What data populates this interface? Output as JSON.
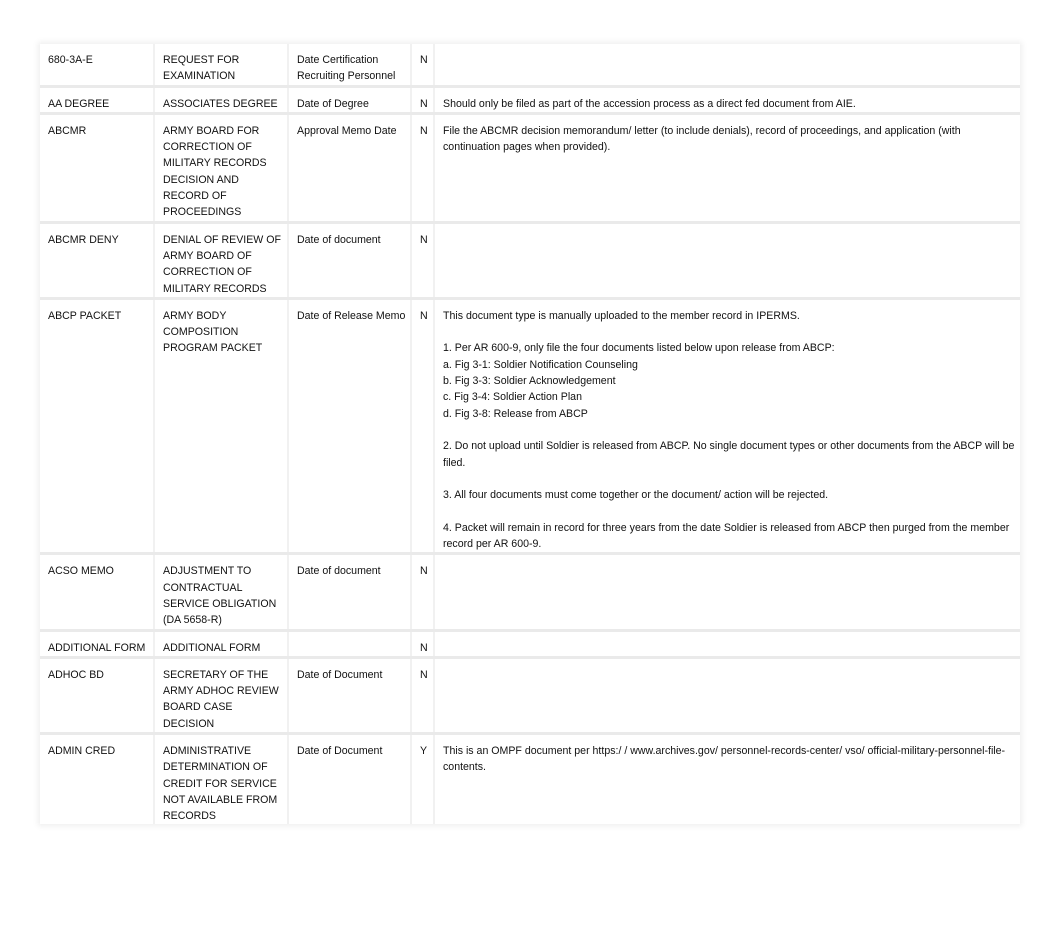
{
  "rows": [
    {
      "code": "680-3A-E",
      "title": "REQUEST FOR\nEXAMINATION",
      "date": "Date Certification Recruiting Personnel",
      "flag": "N",
      "remarks": ""
    },
    {
      "code": "AA DEGREE",
      "title": "ASSOCIATES DEGREE",
      "date": "Date of Degree",
      "flag": "N",
      "remarks": "Should only be filed as part of the accession process as a direct fed document from AIE."
    },
    {
      "code": "ABCMR",
      "title": "ARMY BOARD FOR CORRECTION OF MILITARY RECORDS DECISION AND RECORD OF PROCEEDINGS",
      "date": "Approval Memo Date",
      "flag": "N",
      "remarks": "File the ABCMR decision memorandum/ letter (to include denials), record of proceedings, and application (with continuation pages when provided)."
    },
    {
      "code": "ABCMR DENY",
      "title": "DENIAL OF REVIEW OF ARMY BOARD OF CORRECTION OF MILITARY RECORDS",
      "date": "Date of document",
      "flag": "N",
      "remarks": ""
    },
    {
      "code": "ABCP PACKET",
      "title": "ARMY BODY COMPOSITION PROGRAM PACKET",
      "date": "Date of Release Memo",
      "flag": "N",
      "remarks": "This document type is manually uploaded to the member record in IPERMS.\n\n1. Per AR 600-9, only file the four documents listed below upon release from ABCP:\na. Fig 3-1: Soldier Notification Counseling\nb. Fig 3-3: Soldier Acknowledgement\nc. Fig 3-4: Soldier Action Plan\nd. Fig 3-8: Release from  ABCP\n\n2. Do not upload until Soldier is released from ABCP.  No single document types or other documents from the ABCP will be filed.\n\n3. All four documents must come together or the document/ action will be rejected.\n\n4. Packet will remain in record for three years from the date Soldier is released from ABCP then purged from the member record per AR 600-9."
    },
    {
      "code": "ACSO MEMO",
      "title": "ADJUSTMENT TO CONTRACTUAL SERVICE OBLIGATION (DA 5658-R)",
      "date": "Date of document",
      "flag": "N",
      "remarks": ""
    },
    {
      "code": "ADDITIONAL FORM",
      "title": "ADDITIONAL FORM",
      "date": "",
      "flag": "N",
      "remarks": ""
    },
    {
      "code": "ADHOC BD",
      "title": "SECRETARY OF THE ARMY ADHOC REVIEW BOARD CASE DECISION",
      "date": "Date of Document",
      "flag": "N",
      "remarks": ""
    },
    {
      "code": "ADMIN CRED",
      "title": "ADMINISTRATIVE DETERMINATION OF CREDIT FOR SERVICE NOT AVAILABLE FROM RECORDS",
      "date": "Date of Document",
      "flag": "Y",
      "remarks": "This is an OMPF document per https:/ / www.archives.gov/ personnel-records-center/ vso/ official-military-personnel-file-contents."
    }
  ]
}
